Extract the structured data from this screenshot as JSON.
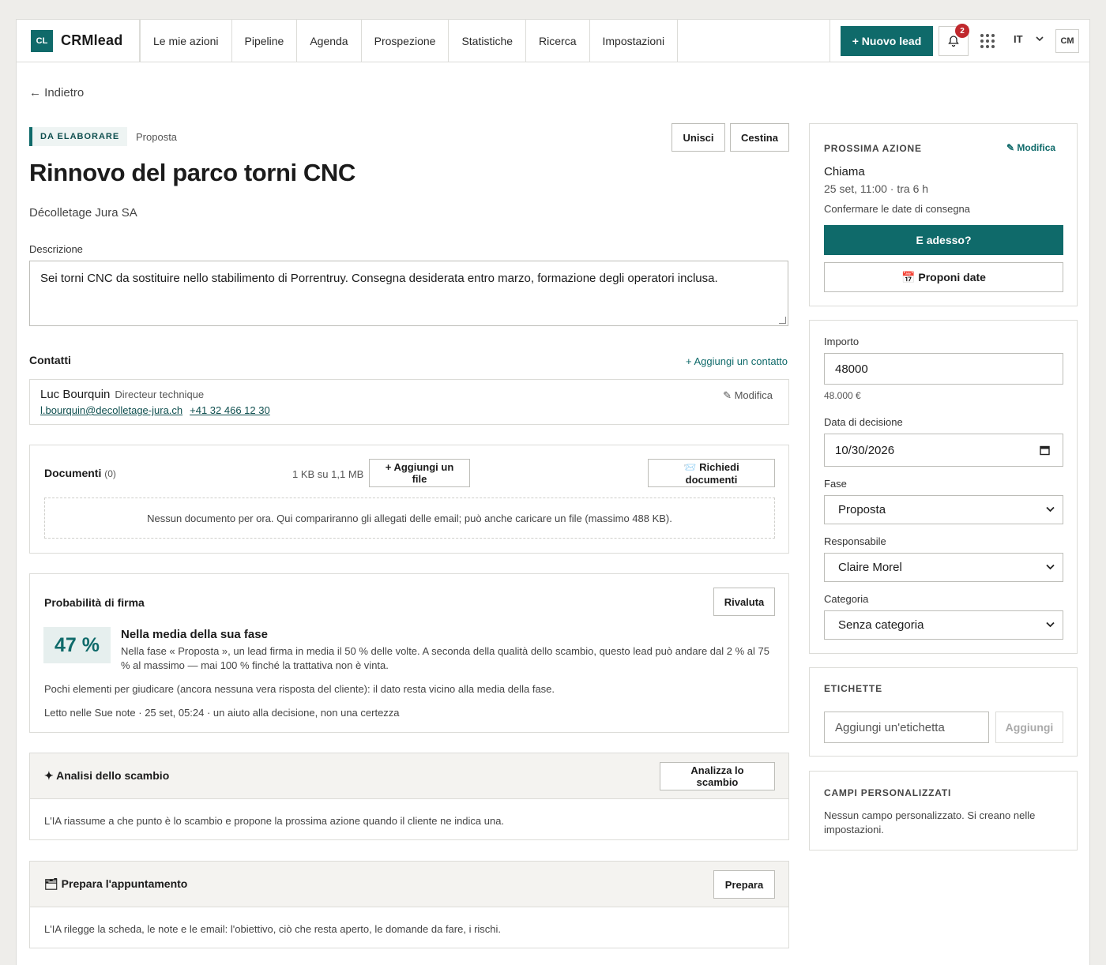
{
  "app": {
    "logo_mark": "CL",
    "logo_text": "CRMlead"
  },
  "nav": [
    "Le mie azioni",
    "Pipeline",
    "Agenda",
    "Prospezione",
    "Statistiche",
    "Ricerca",
    "Impostazioni"
  ],
  "topbar": {
    "new_lead": "+ Nuovo lead",
    "notifications": "2",
    "lang": "IT",
    "avatar": "CM"
  },
  "back": "← Indietro",
  "lead": {
    "status": "DA ELABORARE",
    "stage": "Proposta",
    "title": "Rinnovo del parco torni CNC",
    "company": "Décolletage Jura SA",
    "merge": "Unisci",
    "trash": "Cestina",
    "description_label": "Descrizione",
    "description": "Sei torni CNC da sostituire nello stabilimento di Porrentruy. Consegna desiderata entro marzo, formazione degli operatori inclusa."
  },
  "contacts": {
    "heading": "Contatti",
    "add": "+ Aggiungi un contatto",
    "name": "Luc Bourquin",
    "role": "Directeur technique",
    "email": "l.bourquin@decolletage-jura.ch",
    "phone": "+41 32 466 12 30",
    "edit": "✎ Modifica"
  },
  "documents": {
    "heading": "Documenti",
    "count": "(0)",
    "usage": "1 KB su 1,1 MB",
    "add_file": "+ Aggiungi un file",
    "request": "📨 Richiedi documenti",
    "empty": "Nessun documento per ora. Qui compariranno gli allegati delle email; può anche caricare un file (massimo 488 KB)."
  },
  "probability": {
    "heading": "Probabilità di firma",
    "reevaluate": "Rivaluta",
    "value": "47 %",
    "verdict": "Nella media della sua fase",
    "explanation": "Nella fase « Proposta », un lead firma in media il 50 % delle volte. A seconda della qualità dello scambio, questo lead può andare dal 2 % al 75 % al massimo — mai 100 % finché la trattativa non è vinta.",
    "note": "Pochi elementi per giudicare (ancora nessuna vera risposta del cliente): il dato resta vicino alla media della fase.",
    "source": "Letto nelle Sue note · 25 set, 05:24 · un aiuto alla decisione, non una certezza"
  },
  "analysis": {
    "heading": "✦ Analisi dello scambio",
    "button": "Analizza lo scambio",
    "text": "L'IA riassume a che punto è lo scambio e propone la prossima azione quando il cliente ne indica una."
  },
  "prepare": {
    "heading": "🗂 Prepara l'appuntamento",
    "button": "Prepara",
    "text": "L'IA rilegge la scheda, le note e le email: l'obiettivo, ciò che resta aperto, le domande da fare, i rischi."
  },
  "next_action": {
    "caption": "PROSSIMA AZIONE",
    "edit": "✎ Modifica",
    "type": "Chiama",
    "when": "25 set, 11:00 · tra 6 h",
    "note": "Confermare le date di consegna",
    "cta": "E adesso?",
    "propose": "📅 Proponi date"
  },
  "fields": {
    "amount_label": "Importo",
    "amount": "48000",
    "amount_formatted": "48.000 €",
    "decision_label": "Data di decisione",
    "decision_date": "10/30/2026",
    "stage_label": "Fase",
    "stage": "Proposta",
    "owner_label": "Responsabile",
    "owner": "Claire Morel",
    "category_label": "Categoria",
    "category": "Senza categoria"
  },
  "tags": {
    "caption": "ETICHETTE",
    "placeholder": "Aggiungi un'etichetta",
    "add": "Aggiungi"
  },
  "custom": {
    "caption": "CAMPI PERSONALIZZATI",
    "text": "Nessun campo personalizzato. Si creano nelle impostazioni."
  },
  "colors": {
    "accent": "#0f6a6a",
    "badge": "#c0282d",
    "background": "#eeedea"
  },
  "icons": [
    "bell-icon",
    "apps-grid-icon",
    "chevron-down-icon",
    "calendar-icon",
    "pencil-icon"
  ]
}
